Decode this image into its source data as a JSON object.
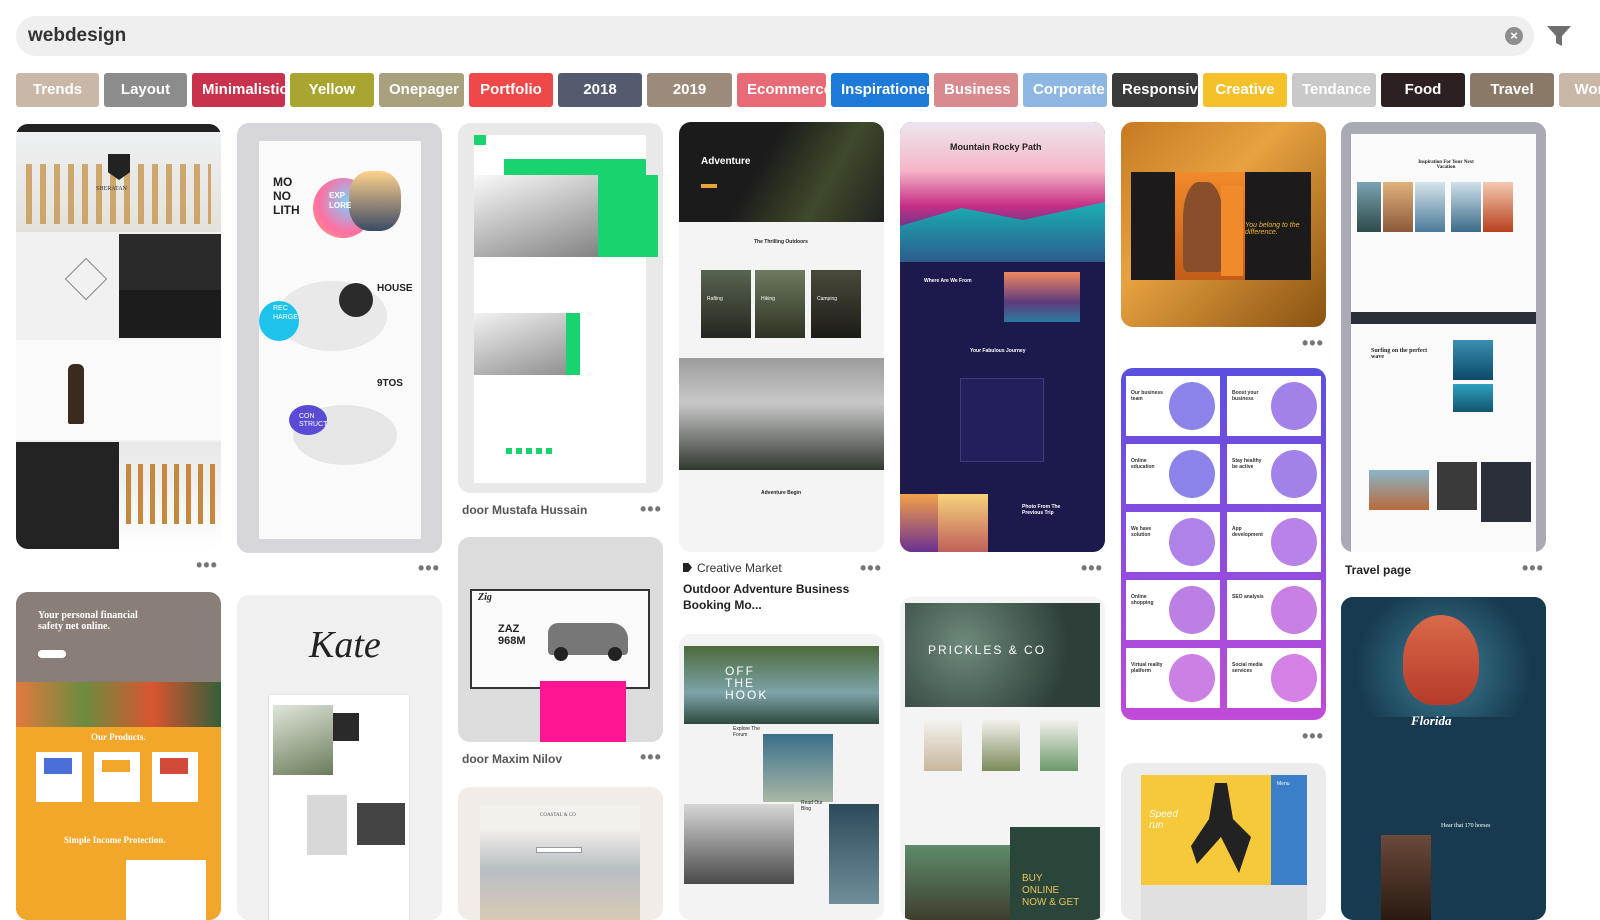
{
  "search": {
    "value": "webdesign",
    "clear_icon": "clear-icon",
    "filter_icon": "filter-icon"
  },
  "tags": [
    {
      "label": "Trends",
      "color": "#c9b8a8"
    },
    {
      "label": "Layout",
      "color": "#8c8c8c"
    },
    {
      "label": "Minimalistic",
      "color": "#c8324d"
    },
    {
      "label": "Yellow",
      "color": "#a8a531"
    },
    {
      "label": "Onepager",
      "color": "#a9a17e"
    },
    {
      "label": "Portfolio",
      "color": "#ee4848"
    },
    {
      "label": "2018",
      "color": "#555b6e"
    },
    {
      "label": "2019",
      "color": "#9c8a7a"
    },
    {
      "label": "Ecommerce",
      "color": "#e86a76"
    },
    {
      "label": "Inspirationen",
      "color": "#1e7ad9"
    },
    {
      "label": "Business",
      "color": "#d98a8f"
    },
    {
      "label": "Corporate",
      "color": "#8eb6e3"
    },
    {
      "label": "Responsive",
      "color": "#3a3a3a"
    },
    {
      "label": "Creative",
      "color": "#f5c12a"
    },
    {
      "label": "Tendance",
      "color": "#c9c9c9"
    },
    {
      "label": "Food",
      "color": "#2c2020"
    },
    {
      "label": "Travel",
      "color": "#8a7966"
    },
    {
      "label": "Wor",
      "color": "#c9b8a8"
    }
  ],
  "pins": {
    "p1": {
      "brand": "SHERATAN"
    },
    "p2": {
      "words": [
        "MO",
        "NO",
        "LITH",
        "EXP",
        "LORE",
        "HOUSE",
        "REC",
        "HARGE",
        "9TOS",
        "CON",
        "STRUCT"
      ]
    },
    "p3": {
      "caption": "door Mustafa Hussain"
    },
    "p4": {
      "hero": "Adventure",
      "section": "The Thrilling Outdoors",
      "labels": [
        "Rafting",
        "Hiking",
        "Camping"
      ],
      "footer": "Adventure Begin",
      "source": "Creative Market",
      "title": "Outdoor Adventure Business Booking Mo..."
    },
    "p5": {
      "title": "Mountain Rocky Path",
      "where": "Where Are We From",
      "journey": "Your Fabulous Journey",
      "photo": "Photo From The Previous Trip"
    },
    "p6": {
      "tagline": "You belong to the difference."
    },
    "p7": {
      "heading": "Inspiration For Your Next Vacation",
      "surf": "Surfing on the perfect wave",
      "caption": "Travel page"
    },
    "p8": {
      "hero": "Your personal financial safety net online.",
      "products": "Our Products.",
      "income": "Simple Income Protection."
    },
    "p9": {
      "name": "Kate"
    },
    "p10": {
      "brand": "Zig",
      "model1": "ZAZ",
      "model2": "968M",
      "caption": "door Maxim Nilov"
    },
    "p11": {
      "title1": "OFF",
      "title2": "THE",
      "title3": "HOOK",
      "explore": "Explore The Forum",
      "read": "Read Our Blog"
    },
    "p12": {
      "brand": "PRICKLES & CO",
      "buy": "BUY ONLINE NOW & GET"
    },
    "p13": {
      "cards": [
        "Our business team",
        "Boost your business",
        "Online education",
        "Stay healthy be active",
        "We have solution",
        "App development",
        "Online shopping",
        "SEO analysis",
        "Virtual reality platform",
        "Social media services"
      ]
    },
    "p14": {
      "speed": "Speed run",
      "menu": "Menu"
    },
    "p15": {
      "title": "Florida",
      "sub": "Hear that 170 horses"
    },
    "p16": {
      "brand": "COASTAL & CO"
    }
  }
}
